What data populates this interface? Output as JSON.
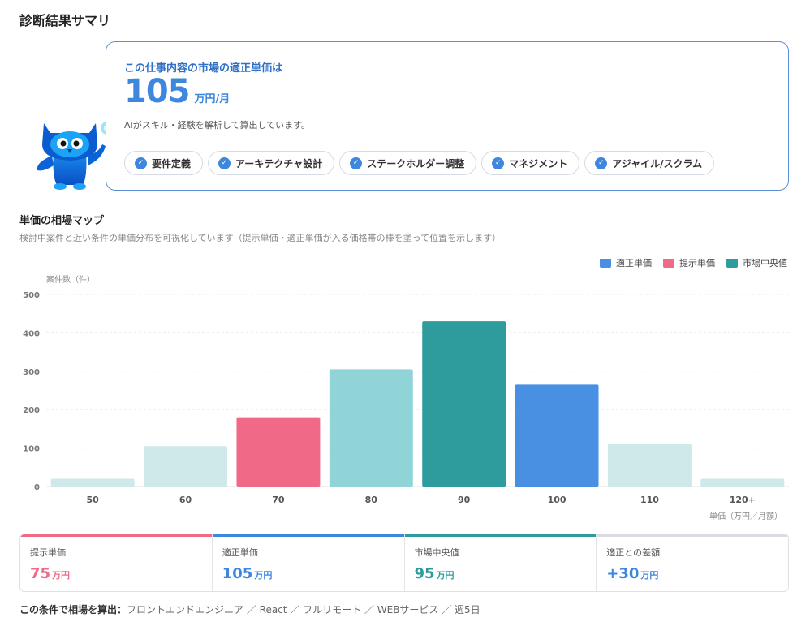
{
  "page_title": "診断結果サマリ",
  "result": {
    "label": "この仕事内容の市場の適正単価は",
    "price": "105",
    "unit": "万円/月",
    "description": "AIがスキル・経験を解析して算出しています。",
    "skills": [
      "要件定義",
      "アーキテクチャ設計",
      "ステークホルダー調整",
      "マネジメント",
      "アジャイル/スクラム"
    ]
  },
  "section": {
    "title": "単価の相場マップ",
    "description": "検討中案件と近い条件の単価分布を可視化しています（提示単価・適正単価が入る価格帯の棒を塗って位置を示します）"
  },
  "legend": [
    {
      "label": "適正単価",
      "color": "#4a90e2"
    },
    {
      "label": "提示単価",
      "color": "#f06a87"
    },
    {
      "label": "市場中央値",
      "color": "#2e9c9c"
    }
  ],
  "chart_data": {
    "type": "bar",
    "ylabel": "案件数（件）",
    "xlabel": "単価（万円／月額）",
    "ylim": [
      0,
      500
    ],
    "yticks": [
      "0",
      "100",
      "200",
      "300",
      "400",
      "500"
    ],
    "categories": [
      "50",
      "60",
      "70",
      "80",
      "90",
      "100",
      "110",
      "120+"
    ],
    "values": [
      20,
      105,
      180,
      305,
      430,
      265,
      110,
      20
    ],
    "bar_colors": [
      "#cfe8ea",
      "#cfe8ea",
      "#f06a87",
      "#90d4d8",
      "#2e9c9c",
      "#4a90e2",
      "#cfe8ea",
      "#cfe8ea"
    ],
    "grid": true
  },
  "stats": [
    {
      "label": "提示単価",
      "value": "75",
      "unit": "万円",
      "color": "#f06a87"
    },
    {
      "label": "適正単価",
      "value": "105",
      "unit": "万円",
      "color": "#3d87de"
    },
    {
      "label": "市場中央値",
      "value": "95",
      "unit": "万円",
      "color": "#2e9c9c"
    },
    {
      "label": "適正との差額",
      "value": "+30",
      "unit": "万円",
      "color": "#3d87de",
      "bar_color": "#d9dde2"
    }
  ],
  "footer": {
    "label": "この条件で相場を算出：",
    "conditions": "フロントエンドエンジニア ／ React ／ フルリモート ／ WEBサービス ／ 週5日"
  }
}
